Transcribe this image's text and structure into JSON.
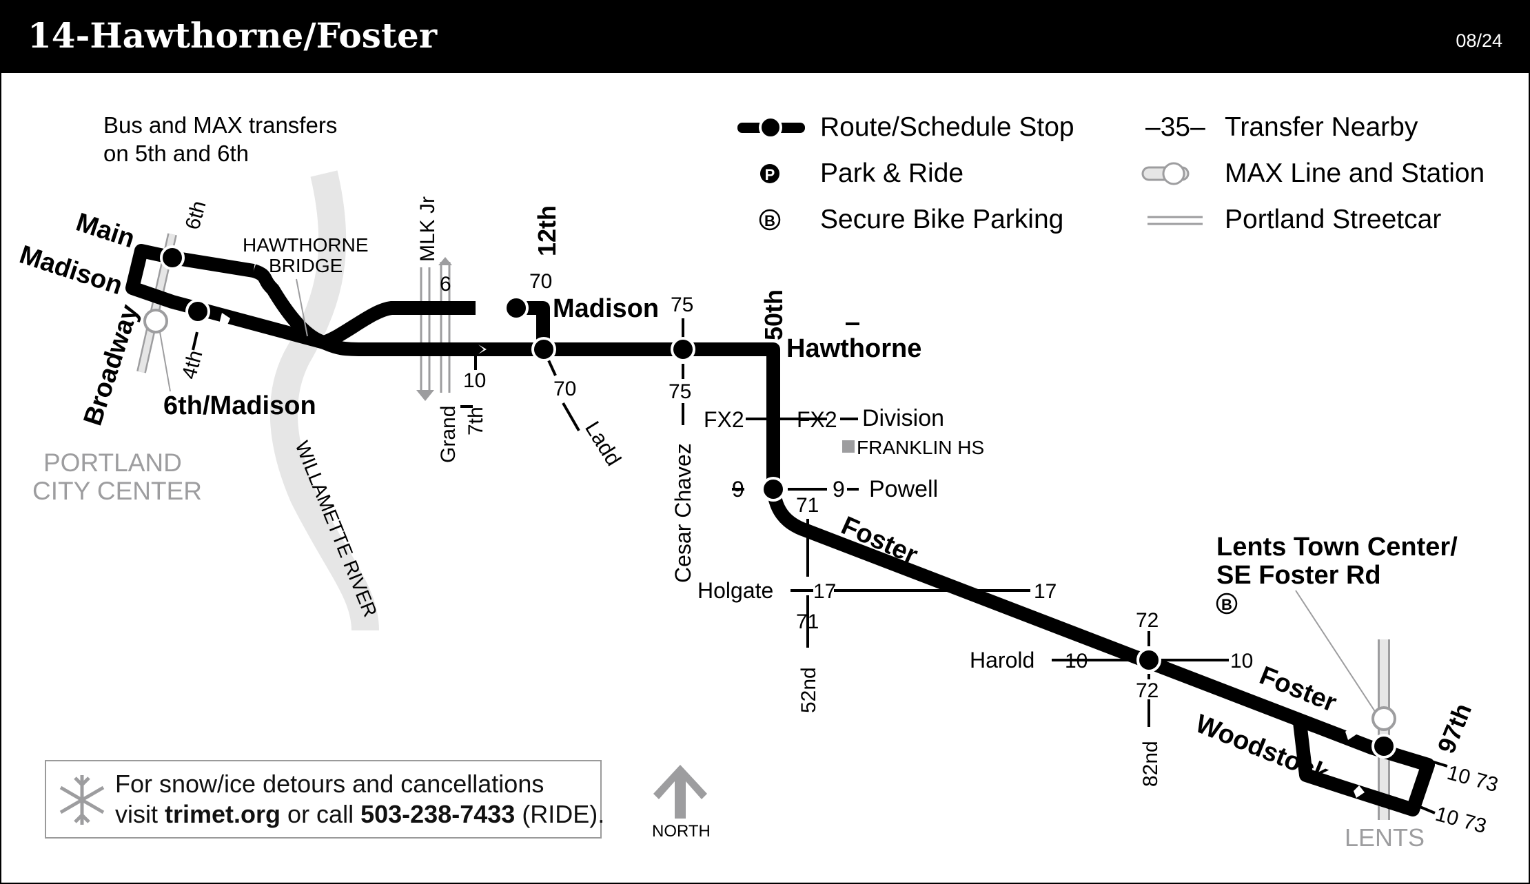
{
  "header": {
    "title": "14-Hawthorne/Foster",
    "date": "08/24"
  },
  "note_transfers": [
    "Bus and MAX transfers",
    "on 5th and 6th"
  ],
  "legend": {
    "route_stop": "Route/Schedule Stop",
    "park_ride": "Park & Ride",
    "bike_parking": "Secure Bike Parking",
    "transfer_nearby_sample": "–35–",
    "transfer_nearby": "Transfer Nearby",
    "max_line": "MAX Line and Station",
    "streetcar": "Portland Streetcar",
    "park_ride_glyph": "P",
    "bike_glyph": "B"
  },
  "streets": {
    "main": "Main",
    "madison_west": "Madison",
    "sixth": "6th",
    "broadway": "Broadway",
    "fourth": "4th",
    "sixth_madison": "6th/Madison",
    "hawthorne_bridge_1": "HAWTHORNE",
    "hawthorne_bridge_2": "BRIDGE",
    "portland_1": "PORTLAND",
    "portland_2": "CITY CENTER",
    "river": "WILLAMETTE  RIVER",
    "mlk": "MLK Jr",
    "grand": "Grand",
    "seventh": "7th",
    "twelfth": "12th",
    "madison_east": "Madison",
    "ladd": "Ladd",
    "cesar_chavez": "Cesar Chavez",
    "fiftieth": "50th",
    "hawthorne": "Hawthorne",
    "division": "Division",
    "franklin": "FRANKLIN HS",
    "powell": "Powell",
    "foster_1": "Foster",
    "holgate": "Holgate",
    "fifty_second": "52nd",
    "harold": "Harold",
    "eighty_second": "82nd",
    "foster_2": "Foster",
    "woodstock": "Woodstock",
    "ninety_seventh": "97th",
    "lents": "LENTS",
    "lents_tc_1": "Lents Town Center/",
    "lents_tc_2": "SE Foster Rd"
  },
  "transfers": {
    "r6": "6",
    "r10_grand": "10",
    "r70_top": "70",
    "r70_bottom": "70",
    "r75_top": "75",
    "r75_bottom": "75",
    "fx2_left": "FX2",
    "fx2_right": "FX2",
    "r9_left": "9",
    "r9_right": "9",
    "r71_top": "71",
    "r71_bottom": "71",
    "r17_left": "17",
    "r17_right": "17",
    "r72_top": "72",
    "r72_bottom": "72",
    "r10_harold": "10",
    "r10_east": "10",
    "lents_routes_top": "10 73",
    "lents_routes_bottom": "10 73"
  },
  "footer": {
    "snow_line1": "For snow/ice detours and cancellations",
    "snow_visit": "visit",
    "snow_site": "trimet.org",
    "snow_call": "or call",
    "snow_phone": "503-238-7433",
    "snow_ride": "(RIDE).",
    "north": "NORTH"
  }
}
